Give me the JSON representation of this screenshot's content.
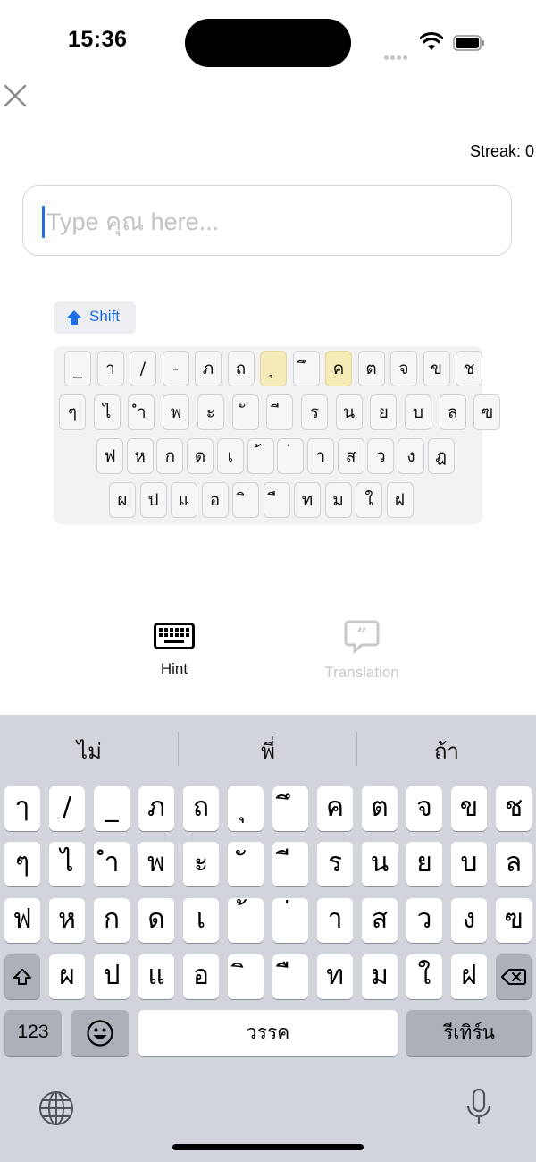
{
  "status": {
    "time": "15:36"
  },
  "streak": "Streak: 0",
  "input": {
    "placeholder": "Type คุณ here...",
    "value": ""
  },
  "shift_label": "Shift",
  "hint_keyboard": {
    "rows": [
      [
        "_",
        "า",
        "/",
        "-",
        "ภ",
        "ถ",
        "ุ",
        "ึ",
        "ค",
        "ต",
        "จ",
        "ข",
        "ช"
      ],
      [
        "ๆ",
        "ไ",
        "ำ",
        "พ",
        "ะ",
        "ั",
        "ี",
        "ร",
        "น",
        "ย",
        "บ",
        "ล",
        "ฃ"
      ],
      [
        "ฟ",
        "ห",
        "ก",
        "ด",
        "เ",
        "้",
        "่",
        "า",
        "ส",
        "ว",
        "ง",
        "ฎ"
      ],
      [
        "ผ",
        "ป",
        "แ",
        "อ",
        "ิ",
        "ื",
        "ท",
        "ม",
        "ใ",
        "ฝ"
      ]
    ],
    "highlighted": [
      "ุ",
      "ค"
    ]
  },
  "bottom_buttons": [
    {
      "label": "Hint",
      "icon": "keyboard-icon",
      "enabled": true
    },
    {
      "label": "Translation",
      "icon": "speech-bubble-quote-icon",
      "enabled": false
    }
  ],
  "system_keyboard": {
    "suggestions": [
      "ไม่",
      "พี่",
      "ถ้า"
    ],
    "rows": [
      [
        "ๅ",
        "/",
        "_",
        "ภ",
        "ถ",
        "ุ",
        "ึ",
        "ค",
        "ต",
        "จ",
        "ข",
        "ช"
      ],
      [
        "ๆ",
        "ไ",
        "ำ",
        "พ",
        "ะ",
        "ั",
        "ี",
        "ร",
        "น",
        "ย",
        "บ",
        "ล"
      ],
      [
        "ฟ",
        "ห",
        "ก",
        "ด",
        "เ",
        "้",
        "่",
        "า",
        "ส",
        "ว",
        "ง",
        "ฃ"
      ],
      [
        "ผ",
        "ป",
        "แ",
        "อ",
        "ิ",
        "ื",
        "ท",
        "ม",
        "ใ",
        "ฝ"
      ]
    ],
    "numbers_label": "123",
    "space_label": "วรรค",
    "return_label": "รีเทิร์น"
  },
  "colors": {
    "accent": "#1e6fe0",
    "highlight": "#f5e9b5",
    "keyboard_bg": "#d1d4da"
  }
}
